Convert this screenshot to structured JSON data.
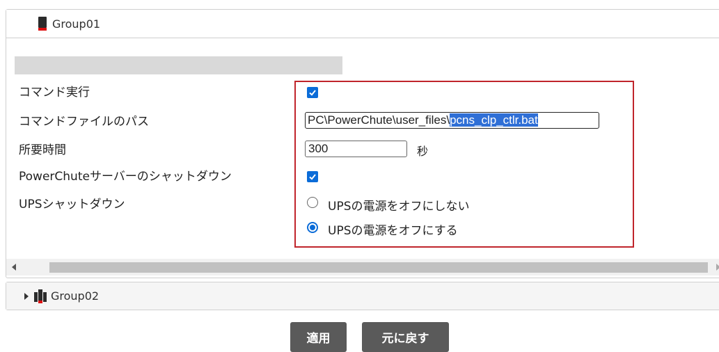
{
  "group01": {
    "title": "Group01"
  },
  "settings": {
    "run_command_label": "コマンド実行",
    "run_command_checked": true,
    "command_path_label": "コマンドファイルのパス",
    "command_path_prefix": "PC\\PowerChute\\user_files\\",
    "command_path_selected": "pcns_clp_ctlr.bat",
    "duration_label": "所要時間",
    "duration_value": "300",
    "duration_unit": "秒",
    "server_shutdown_label": "PowerChuteサーバーのシャットダウン",
    "server_shutdown_checked": true,
    "ups_shutdown_label": "UPSシャットダウン",
    "ups_options": [
      {
        "label": "UPSの電源をオフにしない",
        "selected": false
      },
      {
        "label": "UPSの電源をオフにする",
        "selected": true
      }
    ]
  },
  "group02": {
    "title": "Group02"
  },
  "buttons": {
    "apply": "適用",
    "revert": "元に戻す"
  },
  "colors": {
    "accent": "#0b6cd8",
    "highlight_border": "#c0242b",
    "button_bg": "#5a5a5a"
  }
}
